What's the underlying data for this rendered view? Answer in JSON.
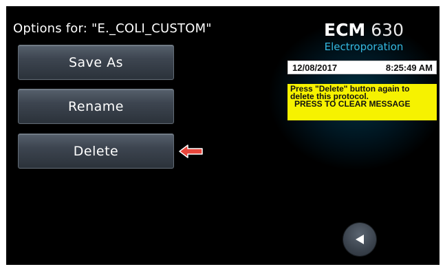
{
  "screen": {
    "title": "Options for: \"E._COLI_CUSTOM\""
  },
  "buttons": {
    "save_as": "Save As",
    "rename": "Rename",
    "delete": "Delete"
  },
  "logo": {
    "brand": "ECM",
    "model": "630",
    "subtitle": "Electroporation"
  },
  "status": {
    "date": "12/08/2017",
    "time": "8:25:49 AM"
  },
  "message": {
    "line1": "Press \"Delete\" button again to",
    "line2": "delete this protocol.",
    "line3": "PRESS TO CLEAR MESSAGE"
  },
  "icons": {
    "pointer": "left-arrow-icon",
    "back": "back-triangle-icon"
  },
  "colors": {
    "background": "#000000",
    "accent_blue": "#34b8e0",
    "message_yellow": "#f6f200",
    "arrow_red": "#e8463c"
  }
}
